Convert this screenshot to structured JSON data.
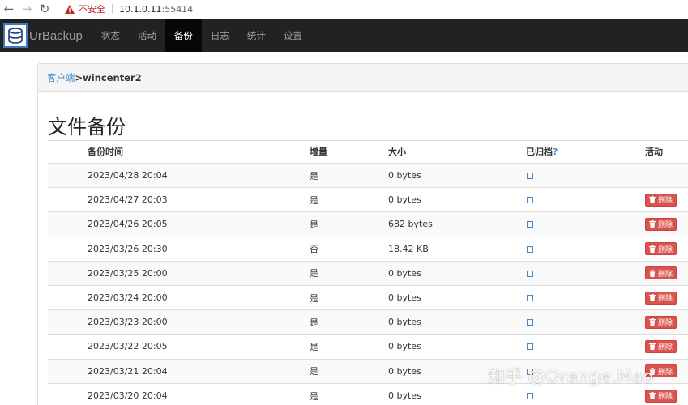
{
  "browser": {
    "back_icon": "arrow-left-icon",
    "forward_icon": "arrow-right-icon",
    "reload_icon": "reload-icon",
    "security_label": "不安全",
    "url_host": "10.1.0.11",
    "url_port": ":55414"
  },
  "navbar": {
    "brand": "UrBackup",
    "items": [
      {
        "label": "状态",
        "active": false
      },
      {
        "label": "活动",
        "active": false
      },
      {
        "label": "备份",
        "active": true
      },
      {
        "label": "日志",
        "active": false
      },
      {
        "label": "统计",
        "active": false
      },
      {
        "label": "设置",
        "active": false
      }
    ]
  },
  "breadcrumb": {
    "link": "客户端",
    "current": ">wincenter2"
  },
  "page": {
    "title": "文件备份"
  },
  "table": {
    "headers": {
      "time": "备份时间",
      "incremental": "增量",
      "size": "大小",
      "archived": "已归档",
      "archived_help": "?",
      "action": "活动"
    },
    "delete_label": "删除",
    "rows": [
      {
        "time": "2023/04/28 20:04",
        "incremental": "是",
        "size": "0 bytes",
        "archived": false,
        "deletable": false
      },
      {
        "time": "2023/04/27 20:03",
        "incremental": "是",
        "size": "0 bytes",
        "archived": false,
        "deletable": true
      },
      {
        "time": "2023/04/26 20:05",
        "incremental": "是",
        "size": "682 bytes",
        "archived": false,
        "deletable": true
      },
      {
        "time": "2023/03/26 20:30",
        "incremental": "否",
        "size": "18.42 KB",
        "archived": false,
        "deletable": true
      },
      {
        "time": "2023/03/25 20:00",
        "incremental": "是",
        "size": "0 bytes",
        "archived": false,
        "deletable": true
      },
      {
        "time": "2023/03/24 20:00",
        "incremental": "是",
        "size": "0 bytes",
        "archived": false,
        "deletable": true
      },
      {
        "time": "2023/03/23 20:00",
        "incremental": "是",
        "size": "0 bytes",
        "archived": false,
        "deletable": true
      },
      {
        "time": "2023/03/22 20:05",
        "incremental": "是",
        "size": "0 bytes",
        "archived": false,
        "deletable": true
      },
      {
        "time": "2023/03/21 20:04",
        "incremental": "是",
        "size": "0 bytes",
        "archived": false,
        "deletable": true
      },
      {
        "time": "2023/03/20 20:04",
        "incremental": "是",
        "size": "0 bytes",
        "archived": false,
        "deletable": true
      }
    ]
  },
  "watermark": "知乎 @Orange.Mao",
  "colors": {
    "navbar_bg": "#222222",
    "navbar_active_bg": "#080808",
    "link": "#428bca",
    "danger": "#d9534f",
    "insecure": "#c5221f"
  }
}
